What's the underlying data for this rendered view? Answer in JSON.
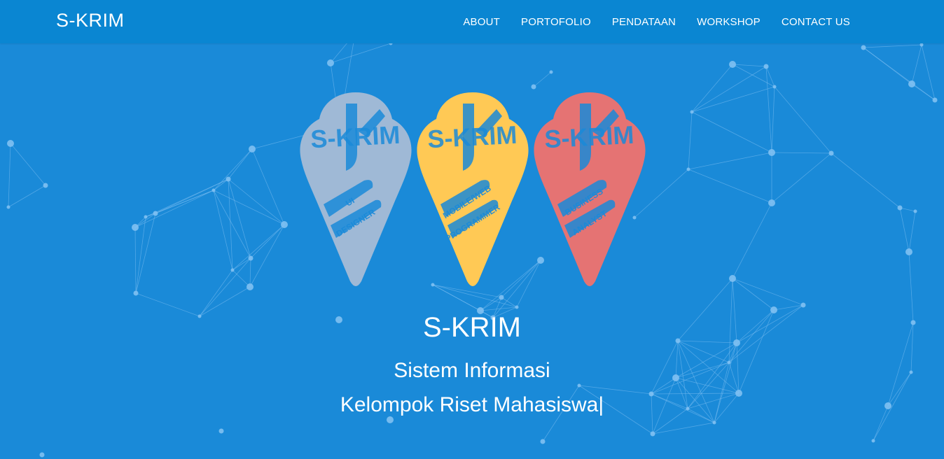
{
  "nav": {
    "brand": "S-KRIM",
    "links": [
      "ABOUT",
      "PORTOFOLIO",
      "PENDATAAN",
      "WORKSHOP",
      "CONTACT US"
    ]
  },
  "logos": [
    {
      "color": "#9fb9d6",
      "top": "S-KRIM",
      "lines": [
        "UI",
        "DESIGNER"
      ],
      "icon": "ice-cream-cone-logo"
    },
    {
      "color": "#ffc955",
      "top": "S-KRIM",
      "lines": [
        "MOBILE/WEB",
        "PROGRAMMER"
      ],
      "icon": "ice-cream-cone-logo"
    },
    {
      "color": "#e57373",
      "top": "S-KRIM",
      "lines": [
        "BUSINESS",
        "ANALYST"
      ],
      "icon": "ice-cream-cone-logo"
    }
  ],
  "hero": {
    "title": "S-KRIM",
    "subtitle_line1": "Sistem Informasi",
    "subtitle_line2": "Kelompok Riset Mahasiswa",
    "cursor": "|"
  },
  "colors": {
    "background": "#1a8ad8",
    "navbar": "#0a86d2",
    "network": "#7fc0f2"
  }
}
